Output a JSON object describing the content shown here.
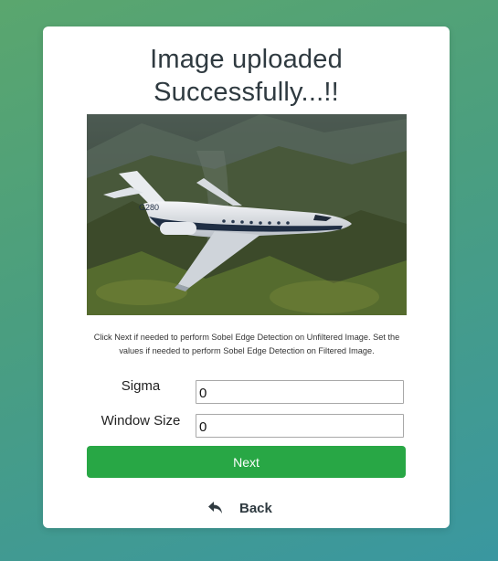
{
  "card": {
    "title_line1": "Image uploaded",
    "title_line2": "Successfully...!!",
    "image_alt": "Uploaded image: G280 business jet flying over green mountains",
    "instructions": "Click Next if needed to perform Sobel Edge Detection on Unfiltered Image. Set the values if needed to perform Sobel Edge Detection on Filtered Image."
  },
  "form": {
    "sigma_label": "Sigma",
    "sigma_value": "0",
    "window_size_label": "Window Size",
    "window_size_value": "0"
  },
  "actions": {
    "next_label": "Next",
    "back_label": "Back",
    "back_icon": "reply-arrow-icon"
  },
  "colors": {
    "next_button": "#28a745",
    "background_start": "#5aa66e",
    "background_end": "#3a97a0"
  }
}
